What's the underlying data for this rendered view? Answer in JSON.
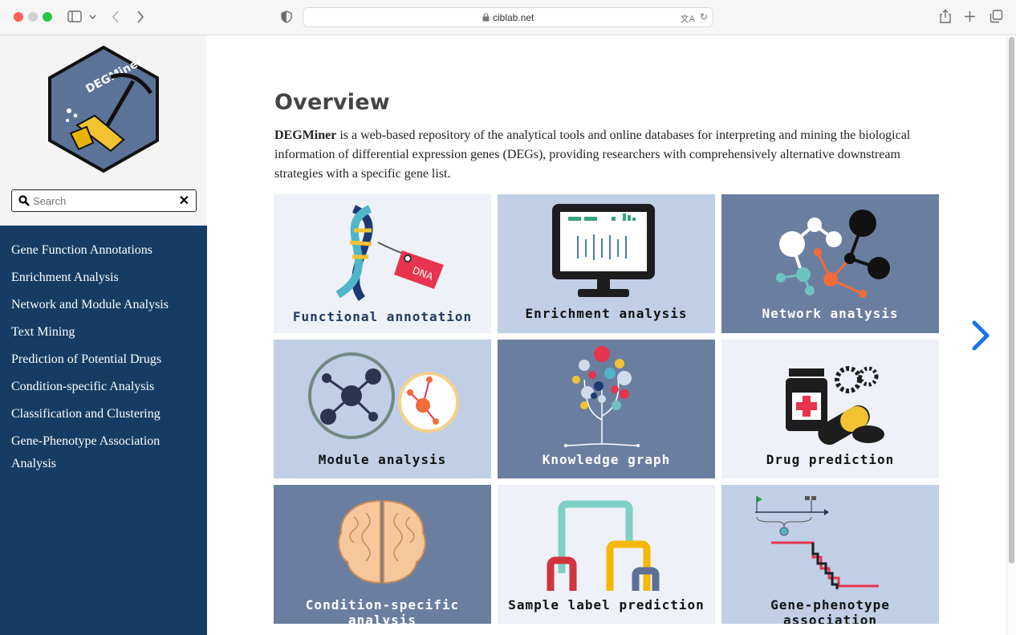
{
  "browser": {
    "url": "ciblab.net"
  },
  "sidebar": {
    "logo_text": "DEGMiner",
    "search": {
      "placeholder": "Search",
      "value": ""
    },
    "items": [
      {
        "label": "Gene Function Annotations"
      },
      {
        "label": "Enrichment Analysis"
      },
      {
        "label": "Network and Module Analysis"
      },
      {
        "label": "Text Mining"
      },
      {
        "label": "Prediction of Potential Drugs"
      },
      {
        "label": "Condition-specific Analysis"
      },
      {
        "label": "Classification and Clustering"
      },
      {
        "label": "Gene-Phenotype Association Analysis"
      }
    ]
  },
  "main": {
    "title": "Overview",
    "intro_bold": "DEGMiner",
    "intro_rest": " is a web-based repository of the analytical tools and online databases for interpreting and mining the biological information of differential expression genes (DEGs), providing researchers with comprehensively alternative downstream strategies with a specific gene list.",
    "tiles": [
      {
        "label": "Functional annotation",
        "bg": "#eef1f8",
        "fg": "#1f3a5f"
      },
      {
        "label": "Enrichment analysis",
        "bg": "#c0cfe6",
        "fg": "#111111"
      },
      {
        "label": "Network analysis",
        "bg": "#6a7fa0",
        "fg": "#ffffff"
      },
      {
        "label": "Module analysis",
        "bg": "#c0cfe6",
        "fg": "#111111"
      },
      {
        "label": "Knowledge graph",
        "bg": "#6a7fa0",
        "fg": "#ffffff"
      },
      {
        "label": "Drug prediction",
        "bg": "#eef1f8",
        "fg": "#111111"
      },
      {
        "label": "Condition-specific analysis",
        "bg": "#6a7fa0",
        "fg": "#ffffff"
      },
      {
        "label": "Sample label prediction",
        "bg": "#eef1f8",
        "fg": "#111111"
      },
      {
        "label": "Gene-phenotype association",
        "bg": "#c0cfe6",
        "fg": "#111111"
      }
    ]
  },
  "colors": {
    "sidebar_nav": "#163c63",
    "next_arrow": "#1a73e8"
  }
}
